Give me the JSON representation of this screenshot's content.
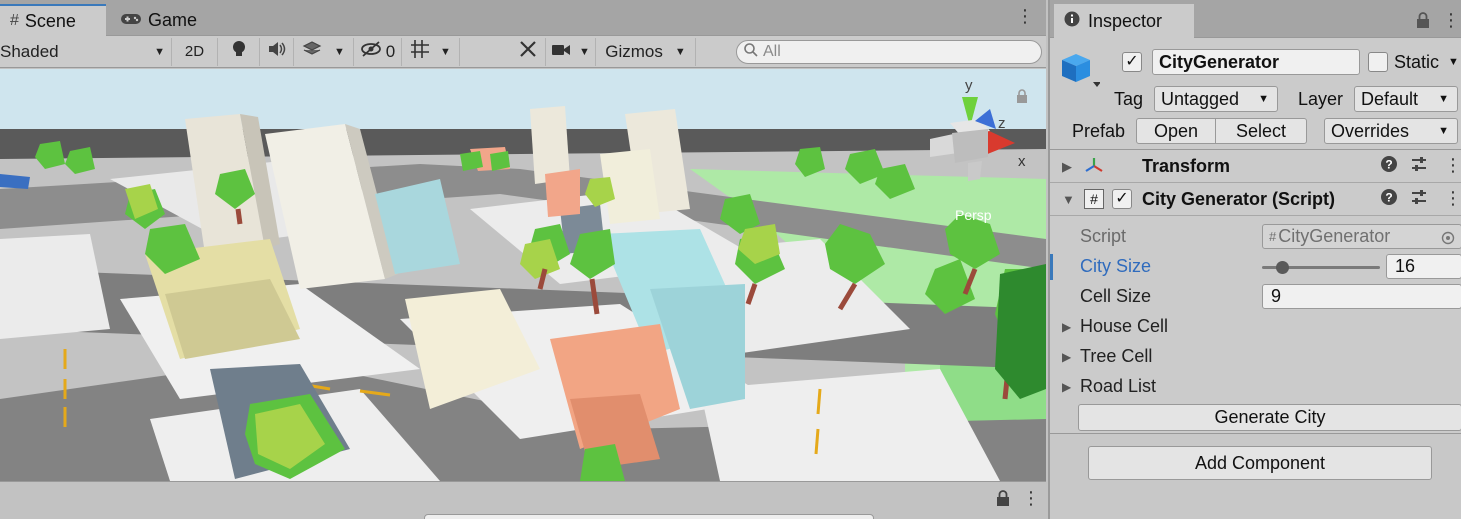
{
  "scene_panel": {
    "tabs": [
      {
        "label": "Scene",
        "icon": "grid-icon",
        "active": true
      },
      {
        "label": "Game",
        "icon": "gamepad-icon",
        "active": false
      }
    ],
    "toolbar": {
      "shading_mode": "Shaded",
      "mode_2d": "2D",
      "hidden_count": "0",
      "gizmos_label": "Gizmos",
      "search_placeholder": "All"
    },
    "orientation_gizmo": {
      "y_label": "y",
      "z_label": "z",
      "x_label": "x",
      "projection": "Persp"
    }
  },
  "inspector": {
    "tab_label": "Inspector",
    "object": {
      "active": true,
      "name": "CityGenerator",
      "static_label": "Static",
      "static_checked": false,
      "tag_label": "Tag",
      "tag_value": "Untagged",
      "layer_label": "Layer",
      "layer_value": "Default",
      "prefab_label": "Prefab",
      "prefab_open": "Open",
      "prefab_select": "Select",
      "prefab_overrides": "Overrides"
    },
    "components": {
      "transform": {
        "title": "Transform"
      },
      "script": {
        "title": "City Generator (Script)",
        "enabled": true,
        "properties": {
          "script_label": "Script",
          "script_value": "CityGenerator",
          "city_size_label": "City Size",
          "city_size_value": "16",
          "city_size_fraction": 0.13,
          "cell_size_label": "Cell Size",
          "cell_size_value": "9",
          "house_cell_label": "House Cell",
          "tree_cell_label": "Tree Cell",
          "road_list_label": "Road List"
        },
        "generate_button": "Generate City"
      }
    },
    "add_component_button": "Add Component"
  },
  "colors": {
    "accent": "#3a79bb",
    "selected_label": "#2f6bbd"
  }
}
